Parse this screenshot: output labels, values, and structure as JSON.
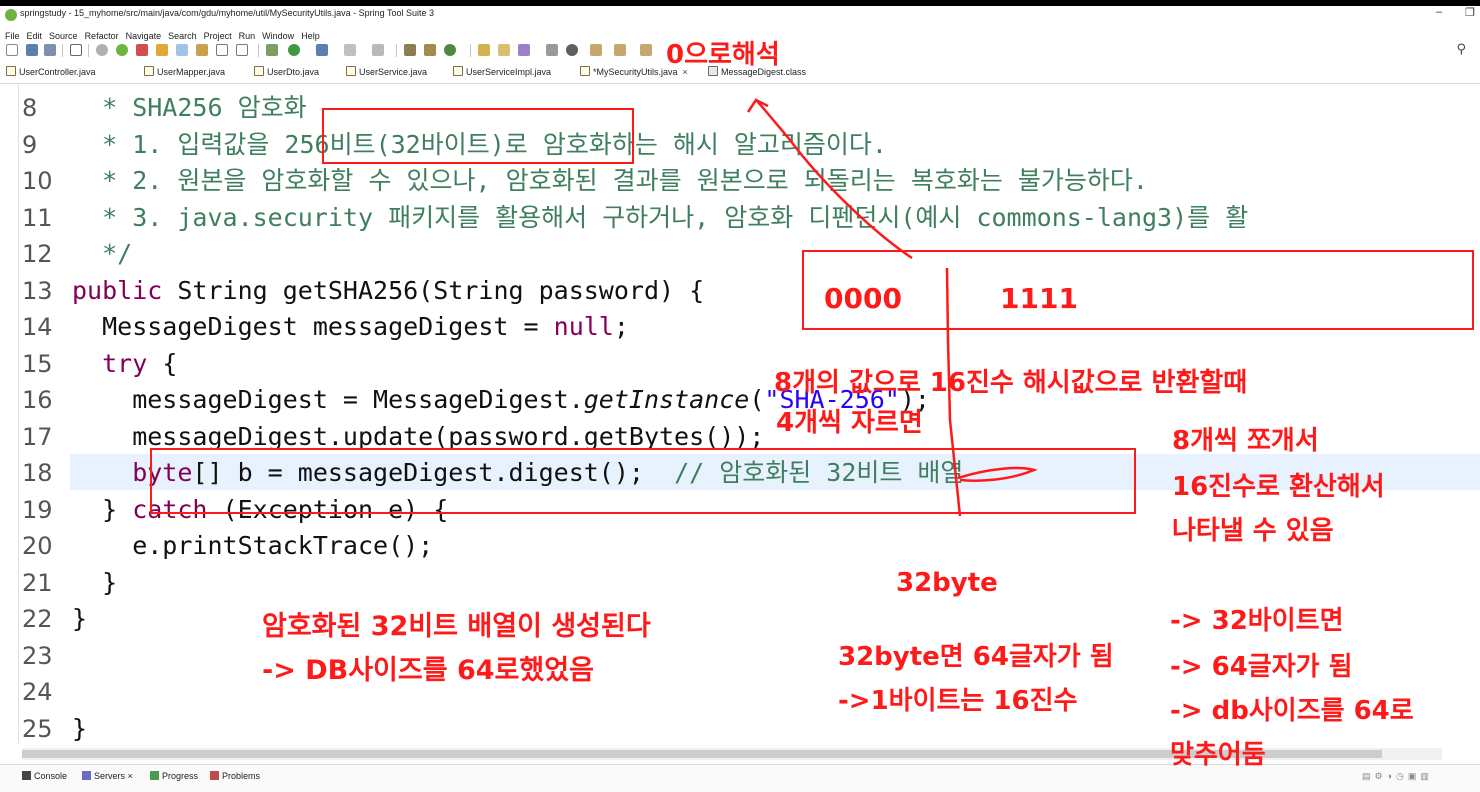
{
  "window": {
    "title": "springstudy - 15_myhome/src/main/java/com/gdu/myhome/util/MySecurityUtils.java - Spring Tool Suite 3",
    "minimize": "–",
    "restore": "❐"
  },
  "menu": [
    "File",
    "Edit",
    "Source",
    "Refactor",
    "Navigate",
    "Search",
    "Project",
    "Run",
    "Window",
    "Help"
  ],
  "tabs": [
    {
      "label": "UserController.java"
    },
    {
      "label": "UserMapper.java"
    },
    {
      "label": "UserDto.java"
    },
    {
      "label": "UserService.java"
    },
    {
      "label": "UserServiceImpl.java"
    },
    {
      "label": "*MySecurityUtils.java",
      "close": "×"
    },
    {
      "label": "MessageDigest.class"
    }
  ],
  "editor": {
    "lines": [
      {
        "n": "8",
        "text": "  * SHA256 암호화"
      },
      {
        "n": "9",
        "text": "  * 1. 입력값을 256비트(32바이트)로 암호화하는 해시 알고리즘이다."
      },
      {
        "n": "10",
        "text": "  * 2. 원본을 암호화할 수 있으나, 암호화된 결과를 원본으로 되돌리는 복호화는 불가능하다."
      },
      {
        "n": "11",
        "text": "  * 3. java.security 패키지를 활용해서 구하거나, 암호화 디펜던시(예시 commons-lang3)를 활"
      },
      {
        "n": "12",
        "text": "  */"
      },
      {
        "n": "13",
        "kw1": "public",
        "t1": " String getSHA256(String password) {"
      },
      {
        "n": "14",
        "t0": "  MessageDigest messageDigest = ",
        "kw1": "null",
        "t1": ";"
      },
      {
        "n": "15",
        "kw1": "  try",
        "t1": " {"
      },
      {
        "n": "16",
        "t0": "    messageDigest = MessageDigest.",
        "it1": "getInstance",
        "t1": "(",
        "str1": "\"SHA-256\"",
        "t2": ");"
      },
      {
        "n": "17",
        "t0": "    messageDigest.update(password.getBytes());"
      },
      {
        "n": "18",
        "kw1": "    byte",
        "t1": "[] b = messageDigest.digest();  ",
        "cmt1": "// 암호화된 32비트 배열"
      },
      {
        "n": "19",
        "t0": "  } ",
        "kw1": "catch",
        "t1": " (Exception e) {"
      },
      {
        "n": "20",
        "t0": "    e.printStackTrace();"
      },
      {
        "n": "21",
        "t0": "  }"
      },
      {
        "n": "22",
        "t0": "}"
      },
      {
        "n": "23",
        "t0": ""
      },
      {
        "n": "24",
        "t0": ""
      },
      {
        "n": "25",
        "t0": "}"
      }
    ]
  },
  "annotations": {
    "zero_hex": "0으로해석",
    "bits_0000": "0000",
    "bits_1111": "1111",
    "eight_values": "8개의 값으로 16진수 해시값으로 반환할때",
    "cut_four": "4개씩 자르면",
    "split_eight": "8개씩 쪼개서",
    "hex_convert": "16진수로 환산해서",
    "can_show": "나타낼 수 있음",
    "bytes32": "32byte",
    "gen_array": "암호화된 32비트 배열이 생성된다",
    "db_size": "-> DB사이즈를 64로했었음",
    "chars64": "32byte면 64글자가 됨",
    "one_byte": "->1바이트는 16진수",
    "if32": "-> 32바이트면",
    "becomes64": "-> 64글자가 됨",
    "dbsize64": "-> db사이즈를 64로",
    "matched": "맞추어둠"
  },
  "bottom_tabs": [
    {
      "label": "Console"
    },
    {
      "label": "Servers",
      "close": "×"
    },
    {
      "label": "Progress"
    },
    {
      "label": "Problems"
    }
  ],
  "colors": {
    "annotation": "#ff1a1a",
    "comment": "#3f7f5f",
    "keyword": "#7f0055",
    "string": "#2a00ff",
    "current_line": "#e8f2fe"
  },
  "icons": {
    "search": "search-icon",
    "file": "java-file-icon",
    "class_file": "class-file-icon"
  }
}
